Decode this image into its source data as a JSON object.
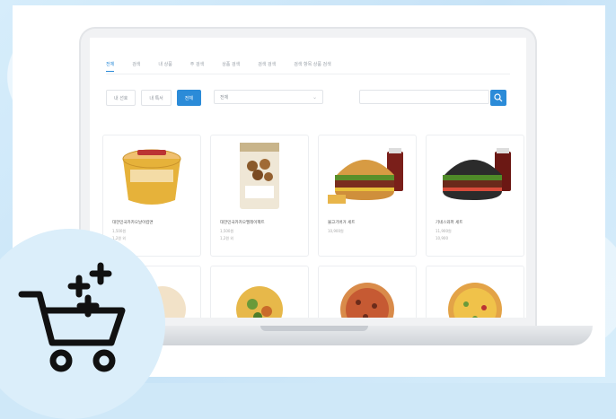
{
  "tabs": [
    "전체",
    "검색",
    "내 상품",
    "주 검색",
    "상품 검색",
    "검색 검색",
    "검색 항목 상품 검색"
  ],
  "filters": [
    "내 선호",
    "내 특서",
    "전체"
  ],
  "select": {
    "value": "전체"
  },
  "search": {
    "placeholder": ""
  },
  "products": [
    {
      "title": "대한민국카카오날이컵면",
      "sub1": "1,500원",
      "sub2": "1,2원 외"
    },
    {
      "title": "대한민국카카오멜레이팩트",
      "sub1": "1,500원",
      "sub2": "1,2원 외"
    },
    {
      "title": "불고기버거 세트",
      "sub1": "10,900원",
      "sub2": ""
    },
    {
      "title": "기네스와퍼 세트",
      "sub1": "11,900원",
      "sub2": "10,900"
    }
  ],
  "colors": {
    "accent": "#2b8bd8",
    "background": "#cfe8f8",
    "badge": "#dbeefa"
  },
  "icons": {
    "cart": "cart-add-icon",
    "search": "search-icon"
  }
}
